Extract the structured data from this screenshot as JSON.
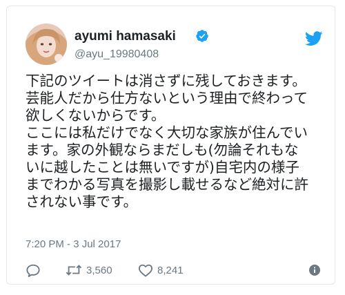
{
  "user": {
    "display_name": "ayumi hamasaki",
    "handle": "@ayu_19980408"
  },
  "tweet": {
    "lines": [
      "下記のツイートは消さずに残しておきます。",
      "芸能人だから仕方ないという理由で終わって",
      "欲しくないからです。",
      "ここには私だけでなく大切な家族が住んでい",
      "ます。家の外観ならまだしも(勿論それもな",
      "いに越したことは無いですが)自宅内の様子",
      "までわかる写真を撮影し載せるなど絶対に許",
      "されない事です。"
    ],
    "timestamp": "7:20 PM - 3 Jul 2017"
  },
  "actions": {
    "retweet_count": "3,560",
    "like_count": "8,241"
  },
  "colors": {
    "twitter_blue": "#1da1f2",
    "text": "#1c2022",
    "muted": "#697882",
    "border": "#e1e8ed"
  },
  "icons": [
    "avatar",
    "verified-badge-icon",
    "twitter-bird-icon",
    "reply-icon",
    "retweet-icon",
    "like-icon",
    "info-icon"
  ]
}
